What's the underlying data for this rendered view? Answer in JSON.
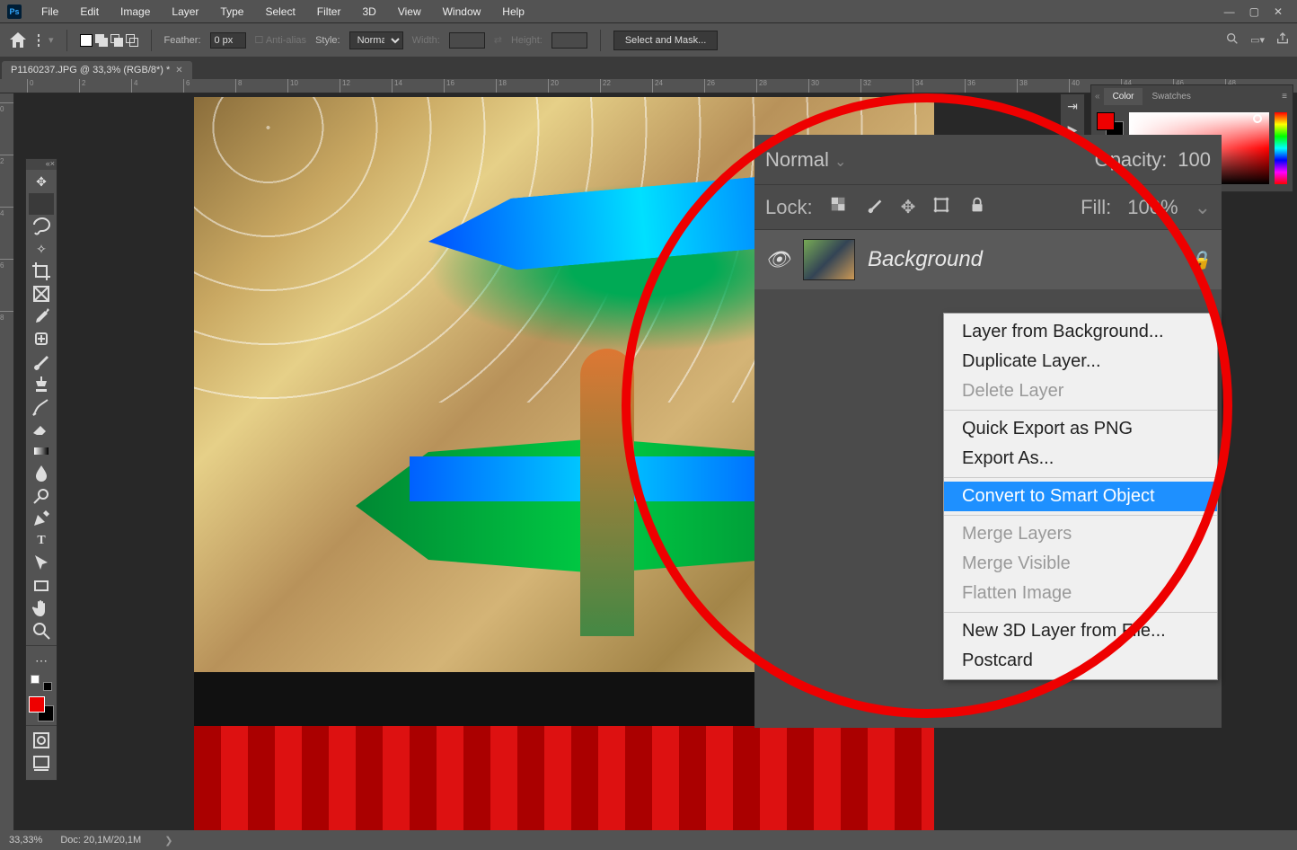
{
  "menubar": {
    "logo": "Ps",
    "items": [
      "File",
      "Edit",
      "Image",
      "Layer",
      "Type",
      "Select",
      "Filter",
      "3D",
      "View",
      "Window",
      "Help"
    ]
  },
  "options": {
    "feather_label": "Feather:",
    "feather_value": "0 px",
    "antialias": "Anti-alias",
    "style_label": "Style:",
    "style_value": "Normal",
    "width_label": "Width:",
    "height_label": "Height:",
    "select_mask": "Select and Mask..."
  },
  "tab": {
    "title": "P1160237.JPG @ 33,3% (RGB/8*) *"
  },
  "ruler_ticks": [
    "0",
    "2",
    "4",
    "6",
    "8",
    "10",
    "12",
    "14",
    "16",
    "18",
    "20",
    "22",
    "24",
    "26",
    "28",
    "30",
    "32",
    "34",
    "36",
    "38",
    "40",
    "44",
    "46",
    "48"
  ],
  "ruler_v": [
    "0",
    "2",
    "4",
    "6",
    "8"
  ],
  "panels": {
    "color_tab": "Color",
    "swatches_tab": "Swatches"
  },
  "layers": {
    "blend_mode": "Normal",
    "opacity_label": "Opacity:",
    "opacity_value": "100",
    "lock_label": "Lock:",
    "fill_label": "Fill:",
    "fill_value": "100%",
    "layer_name": "Background"
  },
  "context_menu": {
    "items": [
      {
        "label": "Layer from Background...",
        "enabled": true
      },
      {
        "label": "Duplicate Layer...",
        "enabled": true
      },
      {
        "label": "Delete Layer",
        "enabled": false
      },
      {
        "sep": true
      },
      {
        "label": "Quick Export as PNG",
        "enabled": true
      },
      {
        "label": "Export As...",
        "enabled": true
      },
      {
        "sep": true
      },
      {
        "label": "Convert to Smart Object",
        "enabled": true,
        "hl": true
      },
      {
        "sep": true
      },
      {
        "label": "Merge Layers",
        "enabled": false
      },
      {
        "label": "Merge Visible",
        "enabled": false
      },
      {
        "label": "Flatten Image",
        "enabled": false
      },
      {
        "sep": true
      },
      {
        "label": "New 3D Layer from File...",
        "enabled": true,
        "truncated": true
      },
      {
        "label": "Postcard",
        "enabled": true
      }
    ]
  },
  "status": {
    "zoom": "33,33%",
    "doc": "Doc: 20,1M/20,1M"
  },
  "tools": [
    "move",
    "marquee",
    "lasso",
    "wand",
    "crop",
    "frame",
    "eyedropper",
    "healing",
    "brush",
    "stamp",
    "history",
    "eraser",
    "gradient",
    "blur",
    "dodge",
    "pen",
    "type",
    "path",
    "rectangle",
    "hand",
    "zoom"
  ]
}
